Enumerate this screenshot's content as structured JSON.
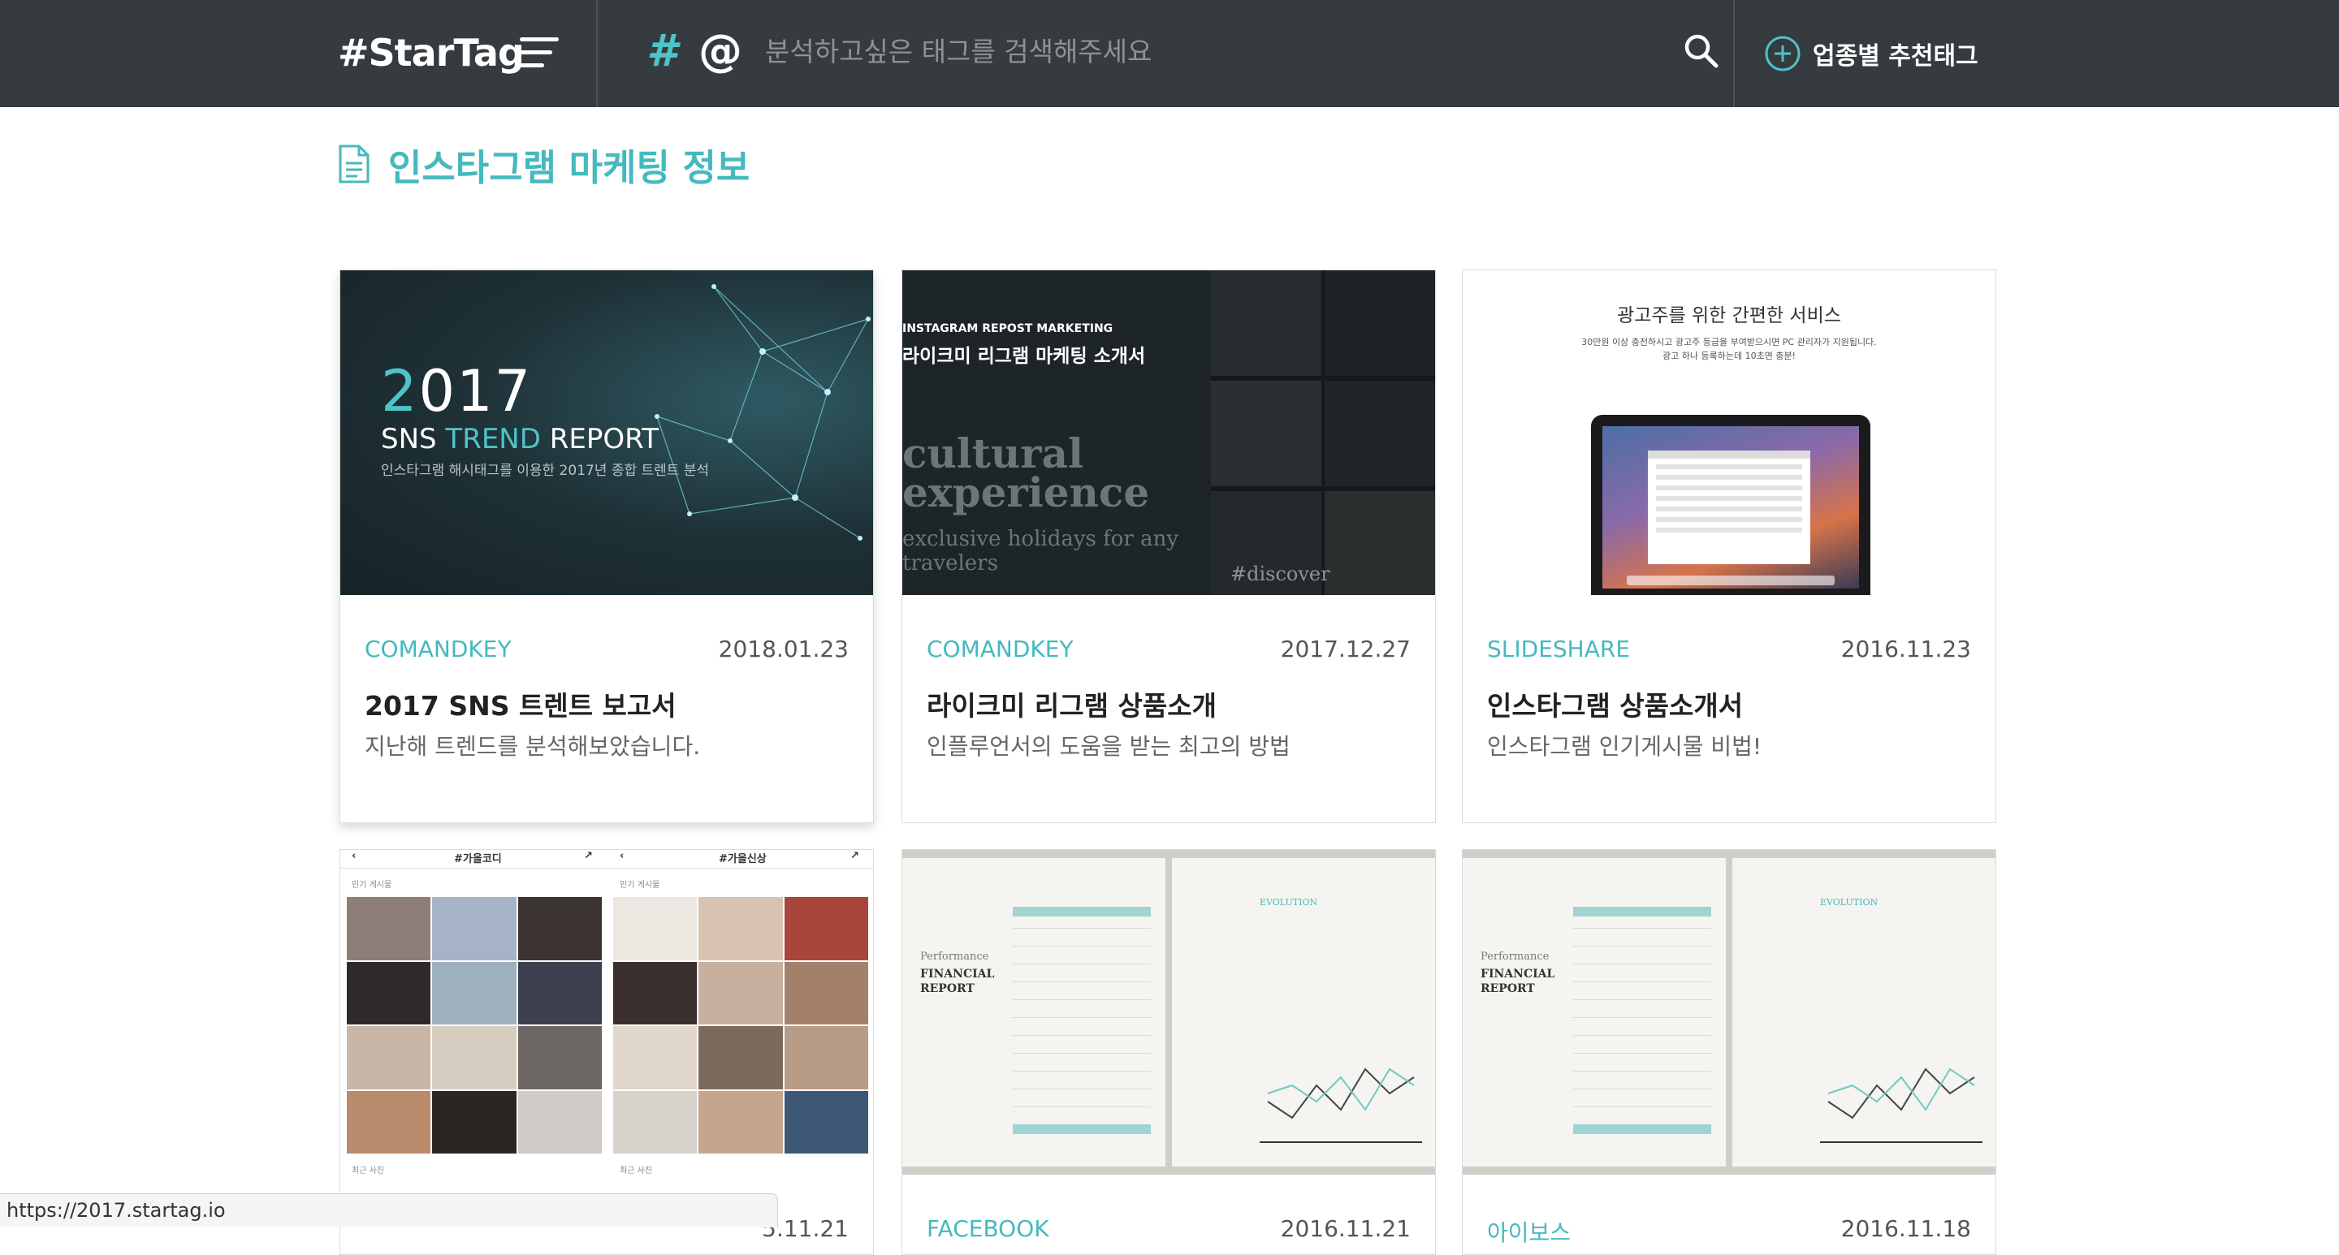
{
  "header": {
    "logo": "#StarTag",
    "hash_glyph": "#",
    "at_glyph": "@",
    "search_placeholder": "분석하고싶은 태그를 검색해주세요",
    "recommend_label": "업종별 추천태그"
  },
  "section": {
    "title": "인스타그램 마케팅 정보"
  },
  "cards": [
    {
      "source": "COMANDKEY",
      "date": "2018.01.23",
      "title": "2017 SNS 트렌트 보고서",
      "description": "지난해 트렌드를 분석해보았습니다.",
      "thumb": {
        "year_accent": "2",
        "year_rest": "017",
        "sub_1": "SNS",
        "sub_accent": "TREND",
        "sub_2": "REPORT",
        "caption": "인스타그램 해시태그를 이용한 2017년 종합 트렌트 분석"
      }
    },
    {
      "source": "COMANDKEY",
      "date": "2017.12.27",
      "title": "라이크미 리그램 상품소개",
      "description": "인플루언서의 도움을 받는 최고의 방법",
      "thumb": {
        "caption_1": "INSTAGRAM REPOST MARKETING",
        "caption_2": "라이크미 리그램 마케팅 소개서",
        "big_1": "cultural",
        "big_2": "experience",
        "small_1": "exclusive holidays for any",
        "small_2": "travelers",
        "tag": "#discover"
      }
    },
    {
      "source": "SLIDESHARE",
      "date": "2016.11.23",
      "title": "인스타그램 상품소개서",
      "description": "인스타그램 인기게시물 비법!",
      "thumb": {
        "title": "광고주를 위한 간편한 서비스",
        "sub_1": "30만원 이상 충전하시고 광고주 등급을 부여받으시면 PC 관리자가 지원됩니다.",
        "sub_2": "광고 하나 등록하는데 10초면 충분!"
      }
    },
    {
      "source": "",
      "date": "5.11.21",
      "title": "",
      "description": "",
      "thumb": {
        "nav_1": "#가을코디",
        "nav_2": "#가을신상",
        "label_1": "인기 게시물",
        "label_2": "인기 게시물",
        "foot_1": "최근 사진",
        "foot_2": "최근 사진"
      }
    },
    {
      "source": "FACEBOOK",
      "date": "2016.11.21",
      "title": "",
      "description": "",
      "thumb": {
        "fin_1": "Performance",
        "fin_2": "FINANCIAL",
        "fin_3": "REPORT",
        "evo": "EVOLUTION"
      }
    },
    {
      "source": "아이보스",
      "date": "2016.11.18",
      "title": "",
      "description": "",
      "thumb": {
        "fin_1": "Performance",
        "fin_2": "FINANCIAL",
        "fin_3": "REPORT",
        "evo": "EVOLUTION"
      }
    }
  ],
  "status_bar": {
    "url": "https://2017.startag.io"
  },
  "colors": {
    "header_bg": "#363b3f",
    "accent": "#45b9be"
  }
}
